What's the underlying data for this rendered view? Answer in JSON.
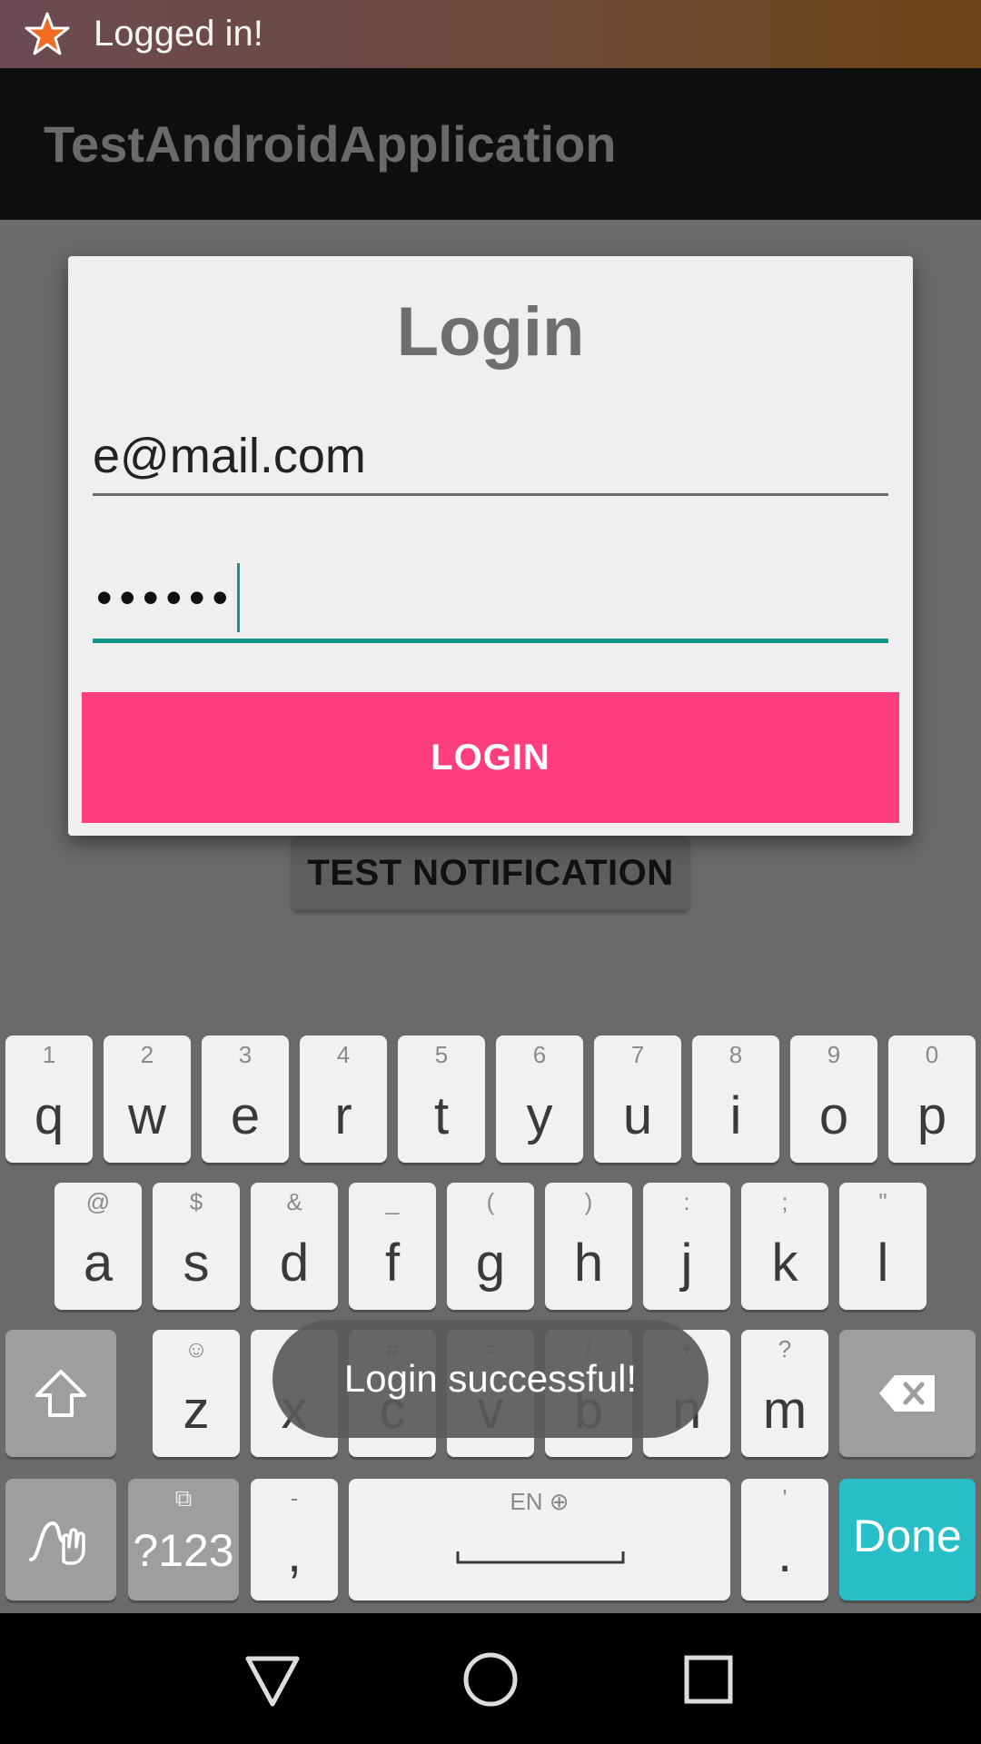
{
  "status_bar": {
    "notification_text": "Logged in!",
    "icon": "star-icon"
  },
  "app_bar": {
    "title": "TestAndroidApplication"
  },
  "background": {
    "test_button_label": "TEST NOTIFICATION"
  },
  "dialog": {
    "title": "Login",
    "email_value": "e@mail.com",
    "password_masked": "••••••",
    "login_button_label": "LOGIN",
    "accent_color": "#14958b",
    "button_color": "#ff3f7d"
  },
  "keyboard": {
    "row1": [
      {
        "hint": "1",
        "key": "q"
      },
      {
        "hint": "2",
        "key": "w"
      },
      {
        "hint": "3",
        "key": "e"
      },
      {
        "hint": "4",
        "key": "r"
      },
      {
        "hint": "5",
        "key": "t"
      },
      {
        "hint": "6",
        "key": "y"
      },
      {
        "hint": "7",
        "key": "u"
      },
      {
        "hint": "8",
        "key": "i"
      },
      {
        "hint": "9",
        "key": "o"
      },
      {
        "hint": "0",
        "key": "p"
      }
    ],
    "row2": [
      {
        "hint": "@",
        "key": "a"
      },
      {
        "hint": "$",
        "key": "s"
      },
      {
        "hint": "&",
        "key": "d"
      },
      {
        "hint": "_",
        "key": "f"
      },
      {
        "hint": "(",
        "key": "g"
      },
      {
        "hint": ")",
        "key": "h"
      },
      {
        "hint": ":",
        "key": "j"
      },
      {
        "hint": ";",
        "key": "k"
      },
      {
        "hint": "\"",
        "key": "l"
      }
    ],
    "row3": [
      {
        "hint": "☺",
        "key": "z"
      },
      {
        "hint": "",
        "key": "x"
      },
      {
        "hint": "#",
        "key": "c"
      },
      {
        "hint": "=",
        "key": "v"
      },
      {
        "hint": "/",
        "key": "b"
      },
      {
        "hint": "+",
        "key": "n"
      },
      {
        "hint": "?",
        "key": "m"
      }
    ],
    "symbols_label": "?123",
    "comma_hint": "-",
    "comma_key": ",",
    "space_hint": "EN ⊕",
    "period_hint": "'",
    "period_key": ".",
    "done_label": "Done",
    "done_color": "#28bec8"
  },
  "toast": {
    "text": "Login successful!"
  }
}
